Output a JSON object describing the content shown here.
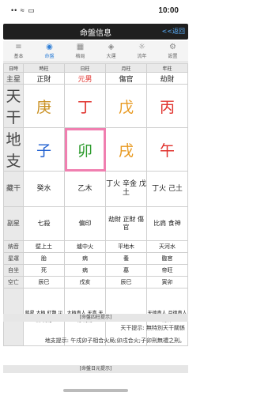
{
  "status": {
    "time": "10:00",
    "icons": "•• ≈ ▭"
  },
  "nav": {
    "title": "命盤信息",
    "back": "<<返回"
  },
  "tabs": [
    {
      "label": "基本",
      "icon": "≡"
    },
    {
      "label": "命盤",
      "icon": "◉"
    },
    {
      "label": "格局",
      "icon": "▦"
    },
    {
      "label": "大運",
      "icon": "◈"
    },
    {
      "label": "流年",
      "icon": "☼"
    },
    {
      "label": "設置",
      "icon": "⚙"
    }
  ],
  "grid": {
    "header": [
      "日時",
      "時柱",
      "日柱",
      "月柱",
      "年柱"
    ],
    "row_labels": {
      "shishen": "主星",
      "tiangan": "天干",
      "dizhi": "地支",
      "canggan": "藏干",
      "fuxing": "副星",
      "nayin": "納音",
      "xingyun": "星運",
      "zizuo": "自坐",
      "kongwang": "空亡",
      "shensha": "神煞"
    },
    "shishen": [
      "正財",
      "元男",
      "傷官",
      "劫財"
    ],
    "tiangan": [
      "庚",
      "丁",
      "戊",
      "丙"
    ],
    "dizhi": [
      "子",
      "卯",
      "戌",
      "午"
    ],
    "canggan": [
      "癸水",
      "乙木",
      "丁火 辛金 戊土",
      "丁火 己土"
    ],
    "fuxing": [
      "七殺",
      "偏印",
      "劫財 正財 傷官",
      "比肩 食神"
    ],
    "nayin": [
      "壁上土",
      "爐中火",
      "平地木",
      "天河水"
    ],
    "xingyun": [
      "胎",
      "病",
      "養",
      "臨官"
    ],
    "zizuo": [
      "死",
      "病",
      "墓",
      "帝旺"
    ],
    "kongwang": [
      "辰巳",
      "戌亥",
      "辰巳",
      "寅卯"
    ],
    "shensha": [
      "將星 太極 紅艷 災煞 桃花",
      "太極貴人 天喜 天德 月德",
      "華蓋 天乙 五鬼",
      "天德貴人 月德貴人 將神"
    ]
  },
  "notes": {
    "bar1": "[命盤四柱提示]",
    "line1": "天干提示: 無特別天干關係",
    "line2": "地支提示: 午戌卯子相合火局;卯戌合火;子卯刑無禮之刑。",
    "bar2": "[命盤日元提示]"
  }
}
